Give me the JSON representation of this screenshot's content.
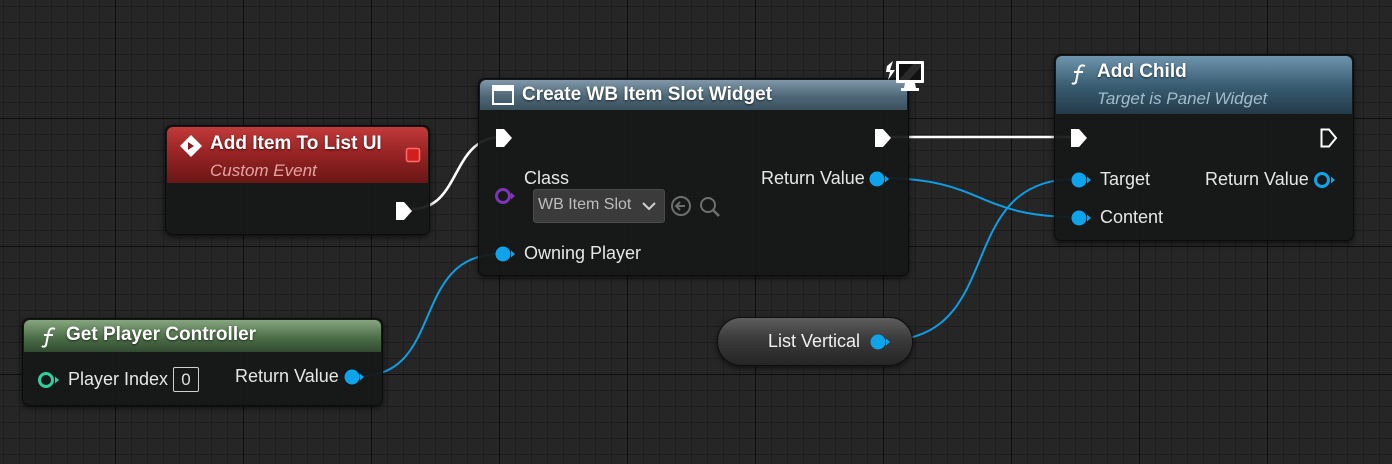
{
  "nodes": {
    "custom_event": {
      "title": "Add Item To List UI",
      "subtitle": "Custom Event",
      "icon": "custom-event-icon",
      "header_color": "#8c1d1d"
    },
    "create_widget": {
      "title": "Create WB Item Slot Widget",
      "class_label": "Class",
      "class_value": "WB Item Slot",
      "owning_player_label": "Owning Player",
      "return_value_label": "Return Value",
      "icon": "widget-icon",
      "header_color": "#4e6878"
    },
    "add_child": {
      "title": "Add Child",
      "subtitle": "Target is Panel Widget",
      "target_label": "Target",
      "content_label": "Content",
      "return_value_label": "Return Value",
      "icon": "function-icon",
      "header_color": "#3a5e73"
    },
    "get_player_controller": {
      "title": "Get Player Controller",
      "player_index_label": "Player Index",
      "player_index_value": "0",
      "return_value_label": "Return Value",
      "icon": "function-icon",
      "header_color": "#4c6e48"
    },
    "list_vertical": {
      "label": "List Vertical"
    }
  },
  "colors": {
    "exec_wire": "#ffffff",
    "object_pin": "#0ea4ec",
    "class_pin": "#6b2ea0",
    "struct_pin": "#2fcf9e"
  }
}
